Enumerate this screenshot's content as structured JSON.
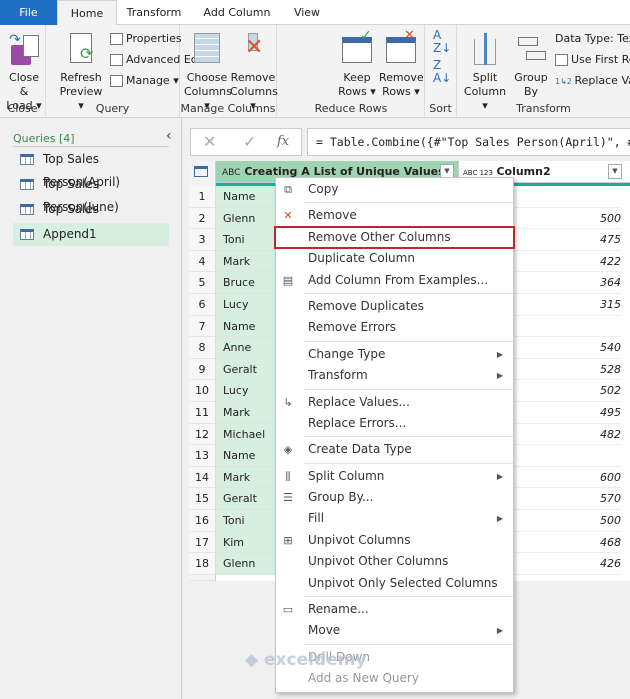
{
  "tabs": [
    "File",
    "Home",
    "Transform",
    "Add Column",
    "View"
  ],
  "ribbon": {
    "close": {
      "button": "Close &",
      "button2": "Load",
      "group": "Close"
    },
    "query": {
      "refresh": "Refresh",
      "refresh2": "Preview",
      "properties": "Properties",
      "advanced_editor": "Advanced Editor",
      "manage": "Manage",
      "group": "Query"
    },
    "manage_columns": {
      "choose": "Choose",
      "choose2": "Columns",
      "remove": "Remove",
      "remove2": "Columns",
      "group": "Manage Columns"
    },
    "reduce_rows": {
      "keep": "Keep",
      "keep2": "Rows",
      "remove": "Remove",
      "remove2": "Rows",
      "group": "Reduce Rows"
    },
    "sort": {
      "group": "Sort"
    },
    "transform": {
      "split": "Split",
      "split2": "Column",
      "group_by": "Group",
      "group_by2": "By",
      "data_type": "Data Type: Text",
      "first_row": "Use First Ro",
      "replace": "Replace Val",
      "group": "Transform"
    }
  },
  "queries": {
    "header": "Queries [4]",
    "items": [
      "Top Sales Person(April)",
      "Top Sales Person(June)",
      "Top Sales Person(May)",
      "Append1"
    ],
    "selected": 3
  },
  "formula": "= Table.Combine({#\"Top Sales Person(April)\", #\"Top Sales Person(June)\"",
  "fx_label": "fx",
  "columns": [
    {
      "type": "ABC",
      "name": "Creating A List of Unique Values"
    },
    {
      "type": "ABC 123",
      "name": "Column2"
    }
  ],
  "rows": [
    [
      "1",
      "Name",
      ""
    ],
    [
      "2",
      "Glenn",
      "500"
    ],
    [
      "3",
      "Toni",
      "475"
    ],
    [
      "4",
      "Mark",
      "422"
    ],
    [
      "5",
      "Bruce",
      "364"
    ],
    [
      "6",
      "Lucy",
      "315"
    ],
    [
      "7",
      "Name",
      ""
    ],
    [
      "8",
      "Anne",
      "540"
    ],
    [
      "9",
      "Geralt",
      "528"
    ],
    [
      "10",
      "Lucy",
      "502"
    ],
    [
      "11",
      "Mark",
      "495"
    ],
    [
      "12",
      "Michael",
      "482"
    ],
    [
      "13",
      "Name",
      ""
    ],
    [
      "14",
      "Mark",
      "600"
    ],
    [
      "15",
      "Geralt",
      "570"
    ],
    [
      "16",
      "Toni",
      "500"
    ],
    [
      "17",
      "Kim",
      "468"
    ],
    [
      "18",
      "Glenn",
      "426"
    ]
  ],
  "menu": [
    {
      "label": "Copy",
      "icon": "copy-icon"
    },
    {
      "sep": true
    },
    {
      "label": "Remove",
      "icon": "remove-icon"
    },
    {
      "label": "Remove Other Columns",
      "highlight": true
    },
    {
      "label": "Duplicate Column"
    },
    {
      "label": "Add Column From Examples...",
      "icon": "examples-icon"
    },
    {
      "sep": true
    },
    {
      "label": "Remove Duplicates"
    },
    {
      "label": "Remove Errors"
    },
    {
      "sep": true
    },
    {
      "label": "Change Type",
      "sub": true
    },
    {
      "label": "Transform",
      "sub": true
    },
    {
      "sep": true
    },
    {
      "label": "Replace Values...",
      "icon": "replace-icon"
    },
    {
      "label": "Replace Errors..."
    },
    {
      "sep": true
    },
    {
      "label": "Create Data Type",
      "icon": "data-type-icon"
    },
    {
      "sep": true
    },
    {
      "label": "Split Column",
      "sub": true,
      "icon": "split-icon"
    },
    {
      "label": "Group By...",
      "icon": "group-by-icon"
    },
    {
      "label": "Fill",
      "sub": true
    },
    {
      "label": "Unpivot Columns",
      "icon": "unpivot-icon"
    },
    {
      "label": "Unpivot Other Columns"
    },
    {
      "label": "Unpivot Only Selected Columns"
    },
    {
      "sep": true
    },
    {
      "label": "Rename...",
      "icon": "rename-icon"
    },
    {
      "label": "Move",
      "sub": true
    },
    {
      "sep": true
    },
    {
      "label": "Drill Down",
      "disabled": true
    },
    {
      "label": "Add as New Query",
      "disabled": true
    }
  ],
  "watermark": "exceldemy",
  "colors": {
    "file_tab": "#1f6fc5",
    "selected_column": "#9fd4b2",
    "highlight_border": "#c0272d",
    "teal": "#16b09a"
  }
}
